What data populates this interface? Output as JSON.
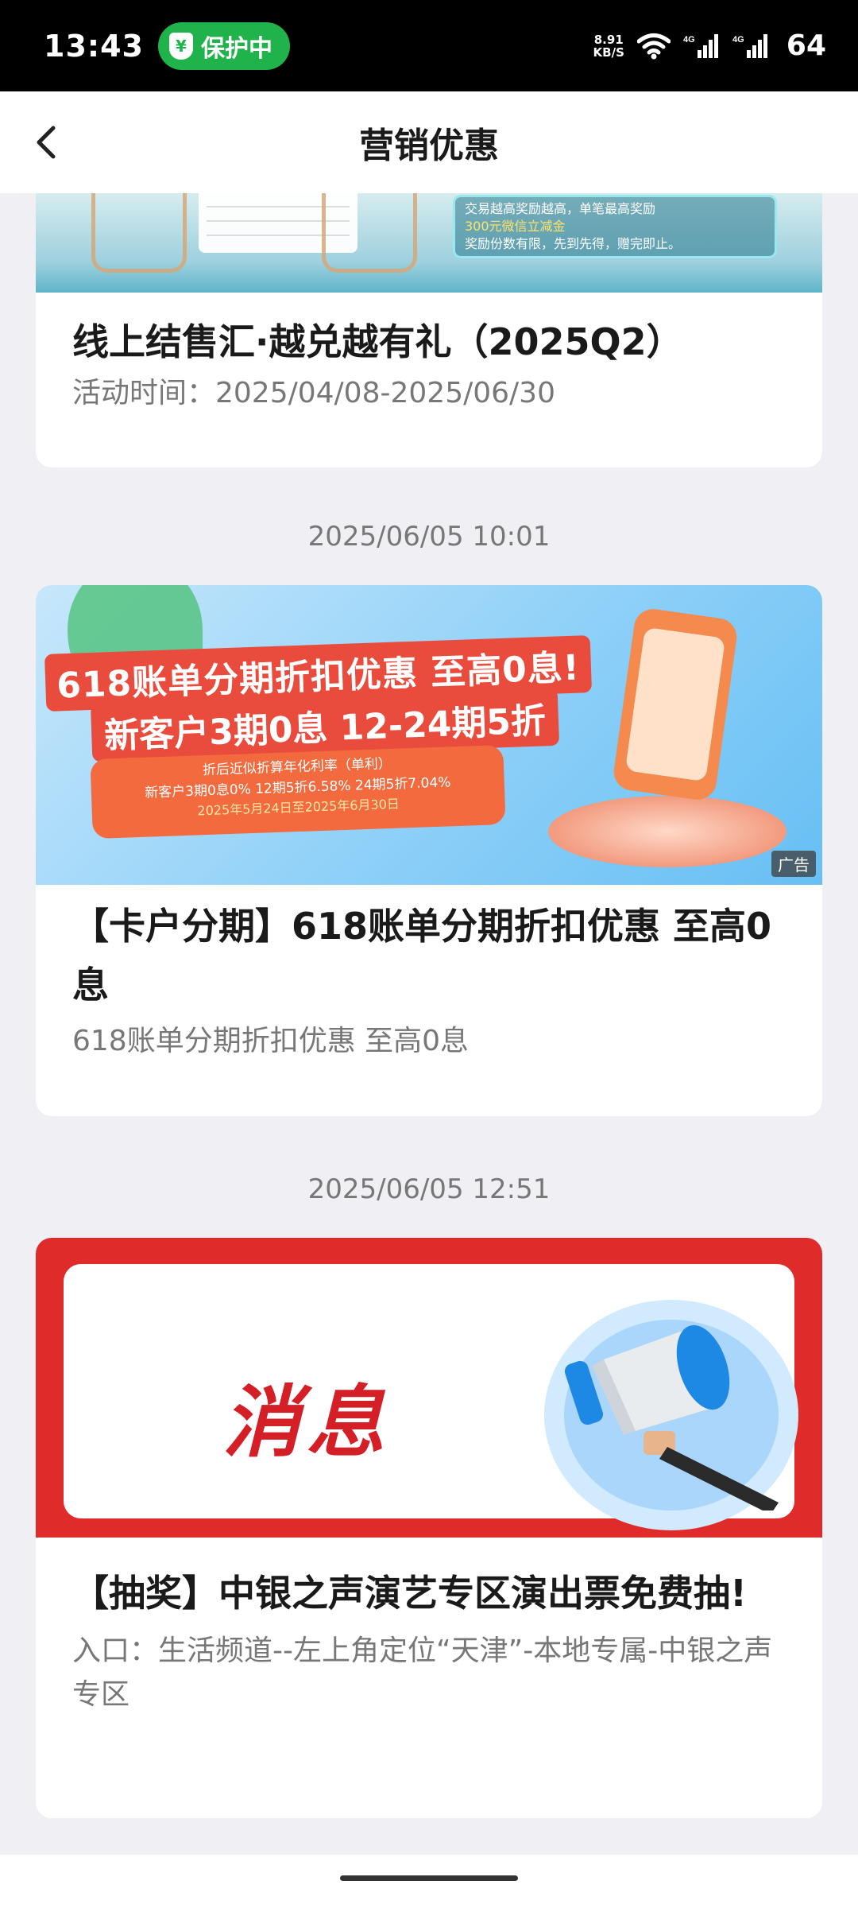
{
  "status_bar": {
    "time": "13:43",
    "protect_label": "保护中",
    "net_speed_value": "8.91",
    "net_speed_unit": "KB/S",
    "battery": "64"
  },
  "nav": {
    "title": "营销优惠"
  },
  "cards": [
    {
      "title": "线上结售汇·越兑越有礼（2025Q2）",
      "subtitle": "活动时间：2025/04/08-2025/06/30",
      "banner_notice_line1": "交易越高奖励越高，单笔最高奖励",
      "banner_notice_line2": "300元微信立减金",
      "banner_notice_line3": "奖励份数有限，先到先得，赠完即止。"
    },
    {
      "timestamp": "2025/06/05 10:01",
      "banner_headline1": "618账单分期折扣优惠 至高0息!",
      "banner_headline2": "新客户3期0息 12-24期5折",
      "banner_line1": "折后近似折算年化利率（单利）",
      "banner_line2": "新客户3期0息0% 12期5折6.58% 24期5折7.04%",
      "banner_line3": "2025年5月24日至2025年6月30日",
      "ad_badge": "广告",
      "title": "【卡户分期】618账单分期折扣优惠 至高0息",
      "subtitle": "618账单分期折扣优惠 至高0息"
    },
    {
      "timestamp": "2025/06/05 12:51",
      "banner_text": "消息",
      "title": "【抽奖】中银之声演艺专区演出票免费抽!",
      "subtitle": "入口：生活频道--左上角定位“天津”-本地专属-中银之声专区"
    }
  ]
}
